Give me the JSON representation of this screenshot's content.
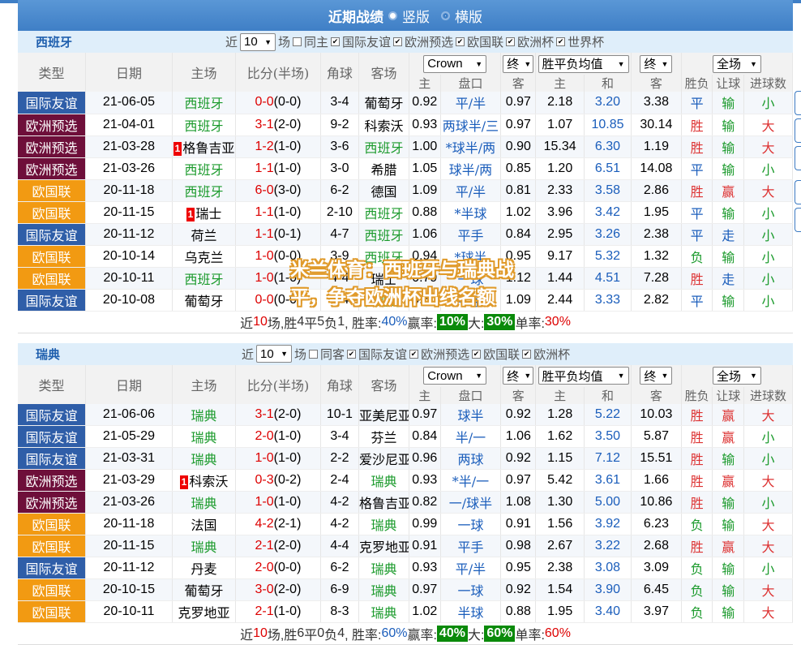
{
  "header": {
    "title": "近期战绩",
    "opt1": "竖版",
    "opt2": "横版"
  },
  "colors": {
    "国际友谊": "#2f5ea8",
    "欧洲预选": "#6e0f3a",
    "欧国联": "#f29a12"
  },
  "watermark": "米兰体育：西班牙与瑞典战平，争夺欧洲杯出线名额",
  "sections": [
    {
      "team": "西班牙",
      "near": "近",
      "count": "10",
      "unit": "场",
      "same": "同主",
      "comps": [
        "国际友谊",
        "欧洲预选",
        "欧国联",
        "欧洲杯",
        "世界杯"
      ],
      "cols": {
        "type": "类型",
        "date": "日期",
        "home": "主场",
        "score": "比分(半场)",
        "corner": "角球",
        "away": "客场",
        "odds": "Crown",
        "end": "终",
        "avg": "胜平负均值",
        "end2": "终",
        "range": "全场",
        "res": "胜负",
        "pan": "让球",
        "ou": "进球数"
      },
      "sub": {
        "h": "主",
        "p": "盘口",
        "a": "客",
        "w": "主",
        "d": "和",
        "l": "客"
      },
      "rows": [
        {
          "type": "国际友谊",
          "date": "21-06-05",
          "home": "西班牙",
          "hg": "0",
          "ag": "0",
          "ht": "(0-0)",
          "corner": "3-4",
          "away": "葡萄牙",
          "o1": "0.92",
          "pk": "平/半",
          "o2": "0.97",
          "w": "2.18",
          "d": "3.20",
          "l": "3.38",
          "res": "平",
          "pan": "输",
          "ou": "小",
          "hs": "green",
          "as": "",
          "rank": ""
        },
        {
          "type": "欧洲预选",
          "date": "21-04-01",
          "home": "西班牙",
          "hg": "3",
          "ag": "1",
          "ht": "(2-0)",
          "corner": "9-2",
          "away": "科索沃",
          "o1": "0.93",
          "pk": "两球半/三",
          "o2": "0.97",
          "w": "1.07",
          "d": "10.85",
          "l": "30.14",
          "res": "胜",
          "pan": "输",
          "ou": "大",
          "hs": "green",
          "as": "",
          "rank": ""
        },
        {
          "type": "欧洲预选",
          "date": "21-03-28",
          "home": "格鲁吉亚",
          "hg": "1",
          "ag": "2",
          "ht": "(1-0)",
          "corner": "3-6",
          "away": "西班牙",
          "o1": "1.00",
          "pk": "*球半/两",
          "o2": "0.90",
          "w": "15.34",
          "d": "6.30",
          "l": "1.19",
          "res": "胜",
          "pan": "输",
          "ou": "大",
          "hs": "",
          "as": "green",
          "rank": "1"
        },
        {
          "type": "欧洲预选",
          "date": "21-03-26",
          "home": "西班牙",
          "hg": "1",
          "ag": "1",
          "ht": "(1-0)",
          "corner": "3-0",
          "away": "希腊",
          "o1": "1.05",
          "pk": "球半/两",
          "o2": "0.85",
          "w": "1.20",
          "d": "6.51",
          "l": "14.08",
          "res": "平",
          "pan": "输",
          "ou": "小",
          "hs": "green",
          "as": "",
          "rank": ""
        },
        {
          "type": "欧国联",
          "date": "20-11-18",
          "home": "西班牙",
          "hg": "6",
          "ag": "0",
          "ht": "(3-0)",
          "corner": "6-2",
          "away": "德国",
          "o1": "1.09",
          "pk": "平/半",
          "o2": "0.81",
          "w": "2.33",
          "d": "3.58",
          "l": "2.86",
          "res": "胜",
          "pan": "赢",
          "ou": "大",
          "hs": "green",
          "as": "",
          "rank": ""
        },
        {
          "type": "欧国联",
          "date": "20-11-15",
          "home": "瑞士",
          "hg": "1",
          "ag": "1",
          "ht": "(1-0)",
          "corner": "2-10",
          "away": "西班牙",
          "o1": "0.88",
          "pk": "*半球",
          "o2": "1.02",
          "w": "3.96",
          "d": "3.42",
          "l": "1.95",
          "res": "平",
          "pan": "输",
          "ou": "小",
          "hs": "",
          "as": "green",
          "rank": "1"
        },
        {
          "type": "国际友谊",
          "date": "20-11-12",
          "home": "荷兰",
          "hg": "1",
          "ag": "1",
          "ht": "(0-1)",
          "corner": "4-7",
          "away": "西班牙",
          "o1": "1.06",
          "pk": "平手",
          "o2": "0.84",
          "w": "2.95",
          "d": "3.26",
          "l": "2.38",
          "res": "平",
          "pan": "走",
          "ou": "小",
          "hs": "",
          "as": "green",
          "rank": ""
        },
        {
          "type": "欧国联",
          "date": "20-10-14",
          "home": "乌克兰",
          "hg": "1",
          "ag": "0",
          "ht": "(0-0)",
          "corner": "3-9",
          "away": "西班牙",
          "o1": "0.94",
          "pk": "*球半",
          "o2": "0.95",
          "w": "9.17",
          "d": "5.32",
          "l": "1.32",
          "res": "负",
          "pan": "输",
          "ou": "小",
          "hs": "",
          "as": "green",
          "rank": ""
        },
        {
          "type": "欧国联",
          "date": "20-10-11",
          "home": "西班牙",
          "hg": "1",
          "ag": "0",
          "ht": "(1-0)",
          "corner": "4-4",
          "away": "瑞士",
          "o1": "0.79",
          "pk": "一球",
          "o2": "1.12",
          "w": "1.44",
          "d": "4.51",
          "l": "7.28",
          "res": "胜",
          "pan": "走",
          "ou": "小",
          "hs": "green",
          "as": "",
          "rank": ""
        },
        {
          "type": "国际友谊",
          "date": "20-10-08",
          "home": "葡萄牙",
          "hg": "0",
          "ag": "0",
          "ht": "(0-0)",
          "corner": "6-4",
          "away": "西班牙",
          "o1": "0.80",
          "pk": "平手",
          "o2": "1.09",
          "w": "2.44",
          "d": "3.33",
          "l": "2.82",
          "res": "平",
          "pan": "输",
          "ou": "小",
          "hs": "",
          "as": "green",
          "rank": ""
        }
      ],
      "summary": {
        "a": "近",
        "n": "10",
        "b": "场,胜",
        "w": "4",
        "c": "平",
        "d": "5",
        "e": "负",
        "l": "1",
        "f": ", 胜率:",
        "wr": "40%",
        "g": " 赢率:",
        "yr": "10%",
        "h": " 大:",
        "br": "30%",
        "i": " 单率:",
        "sr": "30%"
      }
    },
    {
      "team": "瑞典",
      "near": "近",
      "count": "10",
      "unit": "场",
      "same": "同客",
      "comps": [
        "国际友谊",
        "欧洲预选",
        "欧国联",
        "欧洲杯"
      ],
      "cols": {
        "type": "类型",
        "date": "日期",
        "home": "主场",
        "score": "比分(半场)",
        "corner": "角球",
        "away": "客场",
        "odds": "Crown",
        "end": "终",
        "avg": "胜平负均值",
        "end2": "终",
        "range": "全场",
        "res": "胜负",
        "pan": "让球",
        "ou": "进球数"
      },
      "sub": {
        "h": "主",
        "p": "盘口",
        "a": "客",
        "w": "主",
        "d": "和",
        "l": "客"
      },
      "rows": [
        {
          "type": "国际友谊",
          "date": "21-06-06",
          "home": "瑞典",
          "hg": "3",
          "ag": "1",
          "ht": "(2-0)",
          "corner": "10-1",
          "away": "亚美尼亚",
          "o1": "0.97",
          "pk": "球半",
          "o2": "0.92",
          "w": "1.28",
          "d": "5.22",
          "l": "10.03",
          "res": "胜",
          "pan": "赢",
          "ou": "大",
          "hs": "green",
          "as": "",
          "rank": ""
        },
        {
          "type": "国际友谊",
          "date": "21-05-29",
          "home": "瑞典",
          "hg": "2",
          "ag": "0",
          "ht": "(1-0)",
          "corner": "3-4",
          "away": "芬兰",
          "o1": "0.84",
          "pk": "半/一",
          "o2": "1.06",
          "w": "1.62",
          "d": "3.50",
          "l": "5.87",
          "res": "胜",
          "pan": "赢",
          "ou": "小",
          "hs": "green",
          "as": "",
          "rank": ""
        },
        {
          "type": "国际友谊",
          "date": "21-03-31",
          "home": "瑞典",
          "hg": "1",
          "ag": "0",
          "ht": "(1-0)",
          "corner": "2-2",
          "away": "爱沙尼亚",
          "o1": "0.96",
          "pk": "两球",
          "o2": "0.92",
          "w": "1.15",
          "d": "7.12",
          "l": "15.51",
          "res": "胜",
          "pan": "输",
          "ou": "小",
          "hs": "green",
          "as": "",
          "rank": ""
        },
        {
          "type": "欧洲预选",
          "date": "21-03-29",
          "home": "科索沃",
          "hg": "0",
          "ag": "3",
          "ht": "(0-2)",
          "corner": "2-4",
          "away": "瑞典",
          "o1": "0.93",
          "pk": "*半/一",
          "o2": "0.97",
          "w": "5.42",
          "d": "3.61",
          "l": "1.66",
          "res": "胜",
          "pan": "赢",
          "ou": "大",
          "hs": "",
          "as": "green",
          "rank": "1"
        },
        {
          "type": "欧洲预选",
          "date": "21-03-26",
          "home": "瑞典",
          "hg": "1",
          "ag": "0",
          "ht": "(1-0)",
          "corner": "4-2",
          "away": "格鲁吉亚",
          "o1": "0.82",
          "pk": "一/球半",
          "o2": "1.08",
          "w": "1.30",
          "d": "5.00",
          "l": "10.86",
          "res": "胜",
          "pan": "输",
          "ou": "小",
          "hs": "green",
          "as": "",
          "rank": ""
        },
        {
          "type": "欧国联",
          "date": "20-11-18",
          "home": "法国",
          "hg": "4",
          "ag": "2",
          "ht": "(2-1)",
          "corner": "4-2",
          "away": "瑞典",
          "o1": "0.99",
          "pk": "一球",
          "o2": "0.91",
          "w": "1.56",
          "d": "3.92",
          "l": "6.23",
          "res": "负",
          "pan": "输",
          "ou": "大",
          "hs": "",
          "as": "green",
          "rank": ""
        },
        {
          "type": "欧国联",
          "date": "20-11-15",
          "home": "瑞典",
          "hg": "2",
          "ag": "1",
          "ht": "(2-0)",
          "corner": "4-4",
          "away": "克罗地亚",
          "o1": "0.91",
          "pk": "平手",
          "o2": "0.98",
          "w": "2.67",
          "d": "3.22",
          "l": "2.68",
          "res": "胜",
          "pan": "赢",
          "ou": "大",
          "hs": "green",
          "as": "",
          "rank": ""
        },
        {
          "type": "国际友谊",
          "date": "20-11-12",
          "home": "丹麦",
          "hg": "2",
          "ag": "0",
          "ht": "(0-0)",
          "corner": "6-2",
          "away": "瑞典",
          "o1": "0.93",
          "pk": "平/半",
          "o2": "0.95",
          "w": "2.38",
          "d": "3.08",
          "l": "3.09",
          "res": "负",
          "pan": "输",
          "ou": "小",
          "hs": "",
          "as": "green",
          "rank": ""
        },
        {
          "type": "欧国联",
          "date": "20-10-15",
          "home": "葡萄牙",
          "hg": "3",
          "ag": "0",
          "ht": "(2-0)",
          "corner": "6-9",
          "away": "瑞典",
          "o1": "0.97",
          "pk": "一球",
          "o2": "0.92",
          "w": "1.54",
          "d": "3.90",
          "l": "6.45",
          "res": "负",
          "pan": "输",
          "ou": "大",
          "hs": "",
          "as": "green",
          "rank": ""
        },
        {
          "type": "欧国联",
          "date": "20-10-11",
          "home": "克罗地亚",
          "hg": "2",
          "ag": "1",
          "ht": "(1-0)",
          "corner": "8-3",
          "away": "瑞典",
          "o1": "1.02",
          "pk": "半球",
          "o2": "0.88",
          "w": "1.95",
          "d": "3.40",
          "l": "3.97",
          "res": "负",
          "pan": "输",
          "ou": "大",
          "hs": "",
          "as": "green",
          "rank": ""
        }
      ],
      "summary": {
        "a": "近",
        "n": "10",
        "b": "场,胜",
        "w": "6",
        "c": "平",
        "d": "0",
        "e": "负",
        "l": "4",
        "f": ", 胜率:",
        "wr": "60%",
        "g": " 赢率:",
        "yr": "40%",
        "h": " 大:",
        "br": "60%",
        "i": " 单率:",
        "sr": "60%"
      }
    }
  ]
}
